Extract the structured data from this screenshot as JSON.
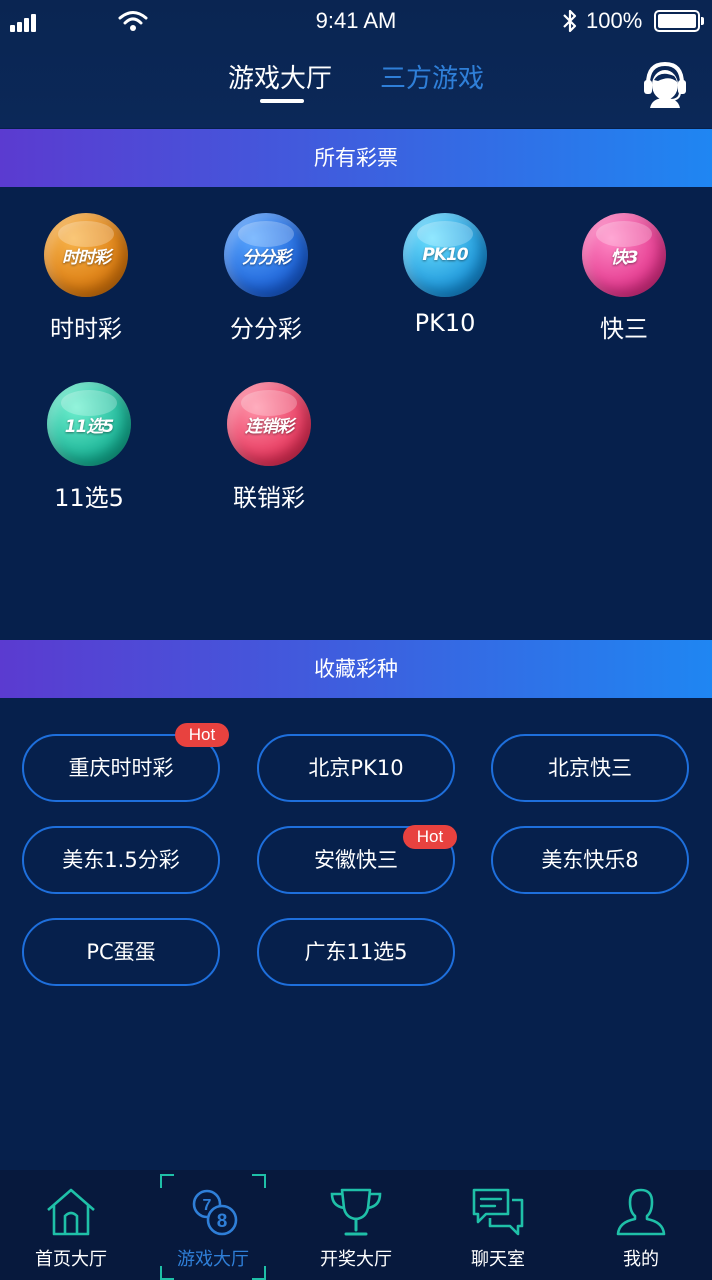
{
  "status_bar": {
    "time": "9:41 AM",
    "battery": "100%"
  },
  "header": {
    "tabs": [
      {
        "label": "游戏大厅",
        "active": true
      },
      {
        "label": "三方游戏",
        "active": false
      }
    ],
    "service_icon": "customer-service-icon"
  },
  "all_lottery": {
    "title": "所有彩票",
    "items": [
      {
        "label": "时时彩",
        "badge_text": "时时彩",
        "icon": "billiard-ball-icon",
        "color": "#e08a14"
      },
      {
        "label": "分分彩",
        "badge_text": "分分彩",
        "icon": "stopwatch-ball-icon",
        "color": "#1f66dc"
      },
      {
        "label": "PK10",
        "badge_text": "PK10",
        "icon": "racecar-ball-icon",
        "color": "#1a93dc"
      },
      {
        "label": "快三",
        "badge_text": "快3",
        "icon": "dice-ball-icon",
        "color": "#e2338a"
      },
      {
        "label": "11选5",
        "badge_text": "11选5",
        "icon": "wave-ball-icon",
        "color": "#15b093"
      },
      {
        "label": "联销彩",
        "badge_text": "连销彩",
        "icon": "sunrise-ball-icon",
        "color": "#e6335a"
      }
    ]
  },
  "favorites": {
    "title": "收藏彩种",
    "hot_label": "Hot",
    "items": [
      {
        "label": "重庆时时彩",
        "hot": true
      },
      {
        "label": "北京PK10",
        "hot": false
      },
      {
        "label": "北京快三",
        "hot": false
      },
      {
        "label": "美东1.5分彩",
        "hot": false
      },
      {
        "label": "安徽快三",
        "hot": true
      },
      {
        "label": "美东快乐8",
        "hot": false
      },
      {
        "label": "PC蛋蛋",
        "hot": false
      },
      {
        "label": "广东11选5",
        "hot": false
      }
    ]
  },
  "bottom_nav": {
    "items": [
      {
        "label": "首页大厅",
        "icon": "home-icon",
        "active": false
      },
      {
        "label": "游戏大厅",
        "icon": "lottery-balls-icon",
        "active": true
      },
      {
        "label": "开奖大厅",
        "icon": "trophy-icon",
        "active": false
      },
      {
        "label": "聊天室",
        "icon": "chat-icon",
        "active": false
      },
      {
        "label": "我的",
        "icon": "user-icon",
        "active": false
      }
    ]
  },
  "colors": {
    "background": "#06204c",
    "accent_blue": "#2f7fd8",
    "nav_green": "#1fc0a8",
    "hot_red": "#e8423f",
    "pill_border": "#1e6fdc"
  }
}
